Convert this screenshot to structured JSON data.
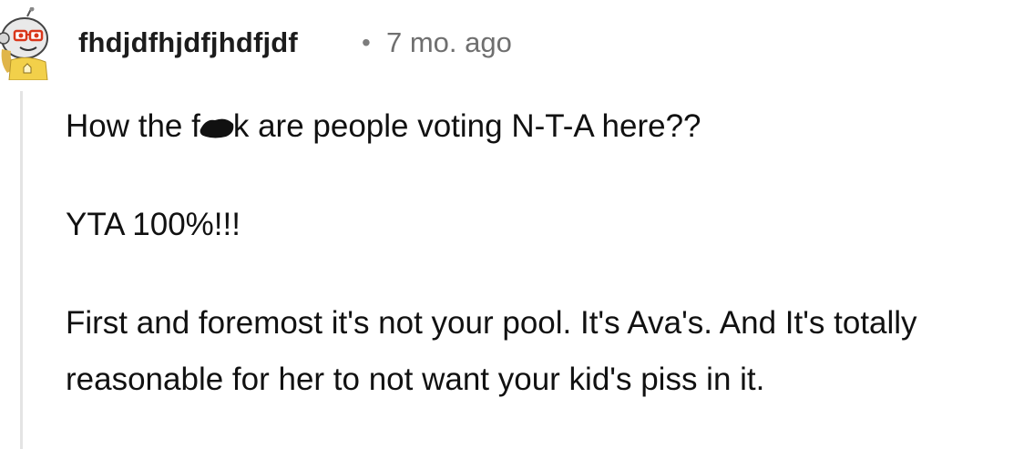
{
  "comment": {
    "author": "fhdjdfhjdfjhdfjdf",
    "separator": "•",
    "timestamp": "7 mo. ago",
    "avatar_icon": "snoo-avatar-icon",
    "body": {
      "line1_before": "How the f",
      "line1_after": "k are people voting N-T-A here??",
      "paragraph2": "YTA 100%!!!",
      "paragraph3": "First and foremost it's not your pool. It's Ava's. And It's totally reasonable for her to not want your kid's piss in it."
    }
  },
  "colors": {
    "thread_line": "#e4e4e4",
    "timestamp": "#6f6f6f",
    "text": "#111111"
  }
}
